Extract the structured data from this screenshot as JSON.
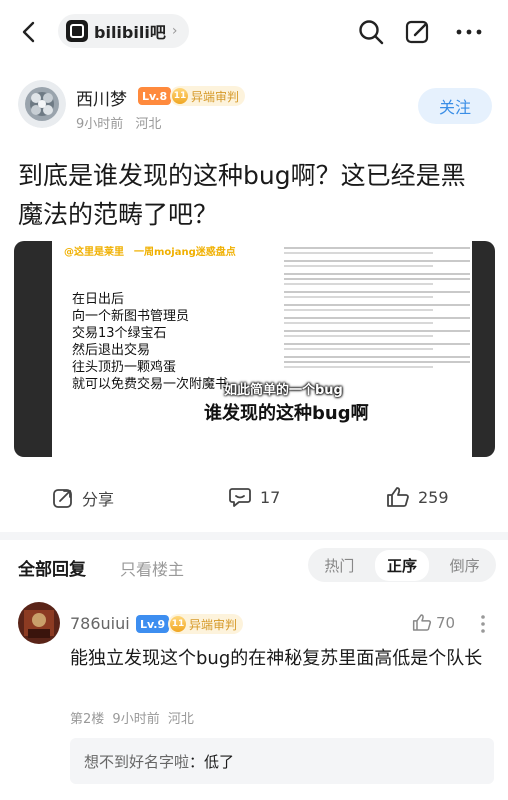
{
  "nav": {
    "forum_name": "bilibili吧",
    "forum_chevron": "›"
  },
  "post": {
    "author": {
      "name": "西川梦",
      "level": "Lv.8",
      "tag": "异端审判",
      "time": "9小时前",
      "location": "河北"
    },
    "follow_label": "关注",
    "title": "到底是谁发现的这种bug啊？这已经是黑魔法的范畴了吧？",
    "image": {
      "header": "@这里是莱里　一周mojang迷惑盘点",
      "text": "在日出后\n向一个新图书管理员\n交易13个绿宝石\n然后退出交易\n往头顶扔一颗鸡蛋\n就可以免费交易一次附魔书",
      "caption_small": "如此简单的一个bug",
      "caption_large": "谁发现的这种bug啊"
    },
    "actions": {
      "share_label": "分享",
      "comment_count": "17",
      "like_count": "259"
    }
  },
  "replies": {
    "tab_all": "全部回复",
    "tab_author_only": "只看楼主",
    "sort_options": [
      "热门",
      "正序",
      "倒序"
    ],
    "sort_active": "正序"
  },
  "comment": {
    "name": "786uiui",
    "level": "Lv.9",
    "tag": "异端审判",
    "like_count": "70",
    "text": "能独立发现这个bug的在神秘复苏里面高低是个队长",
    "floor": "第2楼",
    "time": "9小时前",
    "location": "河北",
    "reply": {
      "name": "想不到好名字啦",
      "separator": "：",
      "text": "低了"
    }
  },
  "colors": {
    "accent": "#3a8ee6",
    "lv8": "#ff8a3d",
    "lv9": "#3d8ef0",
    "tag_text": "#d69a2a"
  }
}
